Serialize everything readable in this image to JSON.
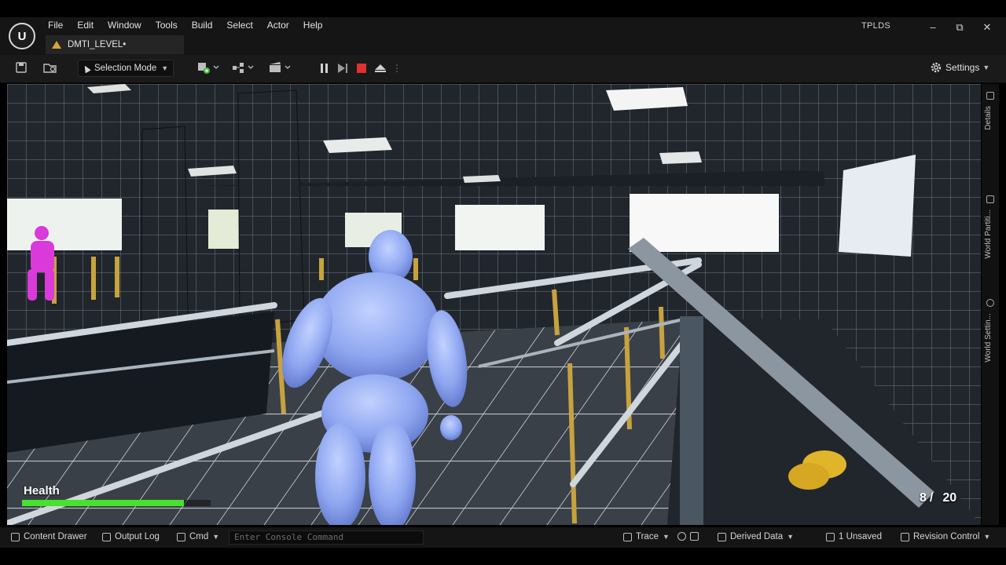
{
  "app": {
    "logo": "U",
    "project": "TPLDS"
  },
  "menu": [
    "File",
    "Edit",
    "Window",
    "Tools",
    "Build",
    "Select",
    "Actor",
    "Help"
  ],
  "level_tab": "DMTI_LEVEL•",
  "window_controls": {
    "minimize": "–",
    "restore": "⧉",
    "close": "✕"
  },
  "toolbar": {
    "mode_label": "Selection Mode",
    "settings_label": "Settings",
    "icons": [
      "save-icon",
      "browse-icon",
      "add-actor-icon",
      "blueprint-icon",
      "cinematics-icon",
      "pause-icon",
      "step-icon",
      "stop-icon",
      "eject-icon"
    ]
  },
  "right_panel": {
    "tabs": [
      "Details",
      "World Partiti...",
      "World Settin..."
    ]
  },
  "hud": {
    "health_label": "Health",
    "health_fraction": 0.86,
    "ammo_current": "8",
    "ammo_sep": "/",
    "ammo_total": "20",
    "accent": "#45e22e"
  },
  "statusbar": {
    "content_drawer": "Content Drawer",
    "output_log": "Output Log",
    "cmd": "Cmd",
    "console_placeholder": "Enter Console Command",
    "trace": "Trace",
    "derived_data": "Derived Data",
    "unsaved": "1 Unsaved",
    "revision_control": "Revision Control"
  }
}
